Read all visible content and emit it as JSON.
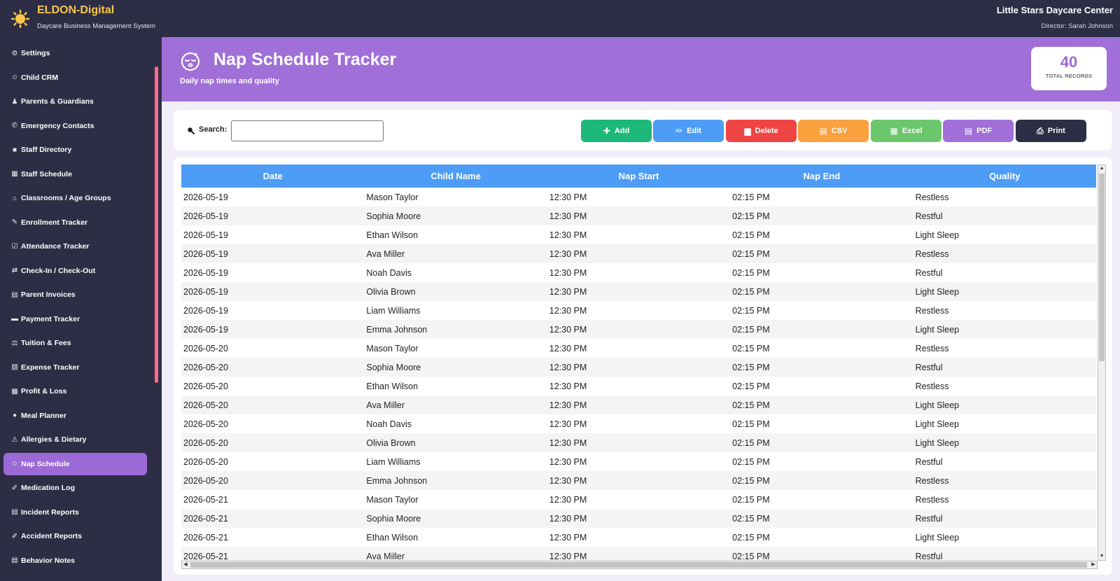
{
  "app": {
    "brand": "ELDON-Digital",
    "subtitle": "Daycare Business Management System",
    "center_name": "Little Stars Daycare Center",
    "director": "Director: Sarah Johnson"
  },
  "sidebar": {
    "items": [
      {
        "label": "Settings",
        "icon": "⚙"
      },
      {
        "label": "Child CRM",
        "icon": "☺"
      },
      {
        "label": "Parents & Guardians",
        "icon": "♟"
      },
      {
        "label": "Emergency Contacts",
        "icon": "✆"
      },
      {
        "label": "Staff Directory",
        "icon": "■"
      },
      {
        "label": "Staff Schedule",
        "icon": "▦"
      },
      {
        "label": "Classrooms / Age Groups",
        "icon": "⌂"
      },
      {
        "label": "Enrollment Tracker",
        "icon": "✎"
      },
      {
        "label": "Attendance Tracker",
        "icon": "☑"
      },
      {
        "label": "Check-In / Check-Out",
        "icon": "⇄"
      },
      {
        "label": "Parent Invoices",
        "icon": "▤"
      },
      {
        "label": "Payment Tracker",
        "icon": "▬"
      },
      {
        "label": "Tuition & Fees",
        "icon": "⚖"
      },
      {
        "label": "Expense Tracker",
        "icon": "▧"
      },
      {
        "label": "Profit & Loss",
        "icon": "▩"
      },
      {
        "label": "Meal Planner",
        "icon": "●"
      },
      {
        "label": "Allergies & Dietary",
        "icon": "⚠"
      },
      {
        "label": "Nap Schedule",
        "icon": "☺",
        "active": true
      },
      {
        "label": "Medication Log",
        "icon": "✐"
      },
      {
        "label": "Incident Reports",
        "icon": "▤"
      },
      {
        "label": "Accident Reports",
        "icon": "✐"
      },
      {
        "label": "Behavior Notes",
        "icon": "▤"
      }
    ]
  },
  "header": {
    "title": "Nap Schedule Tracker",
    "subtitle": "Daily nap times and quality",
    "total_count": "40",
    "total_label": "TOTAL RECORDS"
  },
  "toolbar": {
    "search_label": "Search:",
    "search_value": "",
    "buttons": [
      {
        "label": "Add",
        "icon": "✚",
        "color": "#1db87a"
      },
      {
        "label": "Edit",
        "icon": "✏",
        "color": "#4d9cf5"
      },
      {
        "label": "Delete",
        "icon": "▆",
        "color": "#ef4444"
      },
      {
        "label": "CSV",
        "icon": "▤",
        "color": "#f9a03f"
      },
      {
        "label": "Excel",
        "icon": "▦",
        "color": "#6cc76c"
      },
      {
        "label": "PDF",
        "icon": "▤",
        "color": "#a06fd8"
      },
      {
        "label": "Print",
        "icon": "⎙",
        "color": "#2d2e45"
      }
    ]
  },
  "table": {
    "columns": [
      "Date",
      "Child Name",
      "Nap Start",
      "Nap End",
      "Quality"
    ],
    "rows": [
      [
        "2026-05-19",
        "Mason Taylor",
        "12:30 PM",
        "02:15 PM",
        "Restless"
      ],
      [
        "2026-05-19",
        "Sophia Moore",
        "12:30 PM",
        "02:15 PM",
        "Restful"
      ],
      [
        "2026-05-19",
        "Ethan Wilson",
        "12:30 PM",
        "02:15 PM",
        "Light Sleep"
      ],
      [
        "2026-05-19",
        "Ava Miller",
        "12:30 PM",
        "02:15 PM",
        "Restless"
      ],
      [
        "2026-05-19",
        "Noah Davis",
        "12:30 PM",
        "02:15 PM",
        "Restful"
      ],
      [
        "2026-05-19",
        "Olivia Brown",
        "12:30 PM",
        "02:15 PM",
        "Light Sleep"
      ],
      [
        "2026-05-19",
        "Liam Williams",
        "12:30 PM",
        "02:15 PM",
        "Restless"
      ],
      [
        "2026-05-19",
        "Emma Johnson",
        "12:30 PM",
        "02:15 PM",
        "Light Sleep"
      ],
      [
        "2026-05-20",
        "Mason Taylor",
        "12:30 PM",
        "02:15 PM",
        "Restless"
      ],
      [
        "2026-05-20",
        "Sophia Moore",
        "12:30 PM",
        "02:15 PM",
        "Restful"
      ],
      [
        "2026-05-20",
        "Ethan Wilson",
        "12:30 PM",
        "02:15 PM",
        "Restless"
      ],
      [
        "2026-05-20",
        "Ava Miller",
        "12:30 PM",
        "02:15 PM",
        "Light Sleep"
      ],
      [
        "2026-05-20",
        "Noah Davis",
        "12:30 PM",
        "02:15 PM",
        "Light Sleep"
      ],
      [
        "2026-05-20",
        "Olivia Brown",
        "12:30 PM",
        "02:15 PM",
        "Light Sleep"
      ],
      [
        "2026-05-20",
        "Liam Williams",
        "12:30 PM",
        "02:15 PM",
        "Restful"
      ],
      [
        "2026-05-20",
        "Emma Johnson",
        "12:30 PM",
        "02:15 PM",
        "Restless"
      ],
      [
        "2026-05-21",
        "Mason Taylor",
        "12:30 PM",
        "02:15 PM",
        "Restless"
      ],
      [
        "2026-05-21",
        "Sophia Moore",
        "12:30 PM",
        "02:15 PM",
        "Restful"
      ],
      [
        "2026-05-21",
        "Ethan Wilson",
        "12:30 PM",
        "02:15 PM",
        "Light Sleep"
      ],
      [
        "2026-05-21",
        "Ava Miller",
        "12:30 PM",
        "02:15 PM",
        "Restful"
      ]
    ]
  }
}
